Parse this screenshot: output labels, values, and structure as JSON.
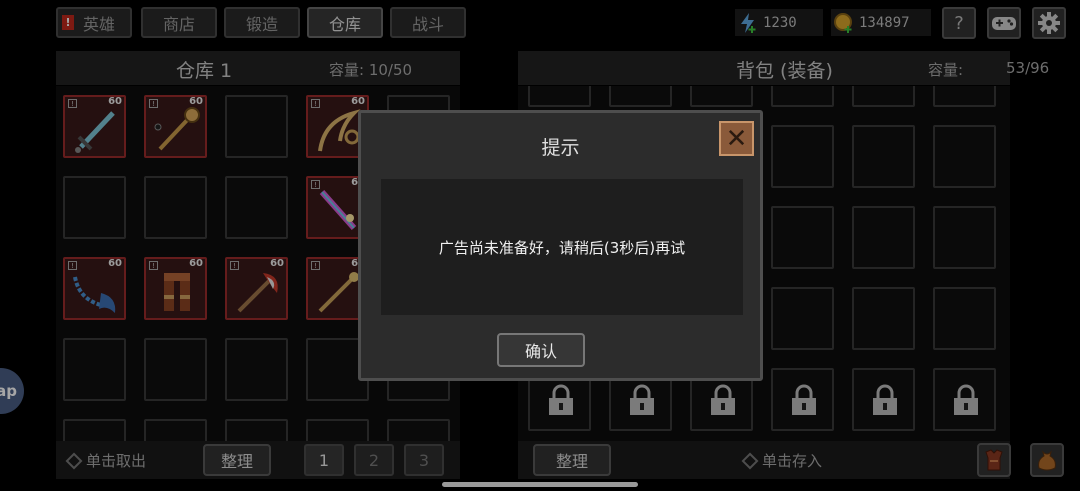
{
  "nav": {
    "tabs": [
      {
        "label": "英雄",
        "alert": "!"
      },
      {
        "label": "商店"
      },
      {
        "label": "锻造"
      },
      {
        "label": "仓库"
      },
      {
        "label": "战斗"
      }
    ],
    "active_tab": "仓库"
  },
  "resources": {
    "energy": "1230",
    "gold": "134897"
  },
  "top_icons": {
    "help": "?"
  },
  "warehouse": {
    "title": "仓库 1",
    "capacity_label": "容量: 10/50",
    "item_level": "60",
    "withdraw_hint": "单击取出",
    "sort_label": "整理",
    "pages": [
      "1",
      "2",
      "3"
    ]
  },
  "backpack": {
    "title": "背包 (装备)",
    "capacity_label": "容量:",
    "capacity_value": "53/96",
    "deposit_hint": "单击存入",
    "sort_label": "整理"
  },
  "dialog": {
    "title": "提示",
    "message": "广告尚未准备好，请稍后(3秒后)再试",
    "ok_label": "确认",
    "close_glyph": "✕"
  },
  "side_bubble": {
    "text": "ap"
  },
  "colors": {
    "item_border": "#9b2c2c",
    "dialog_close": "#8a5a3a",
    "energy": "#5fa8e0",
    "gold": "#d9a52b"
  }
}
